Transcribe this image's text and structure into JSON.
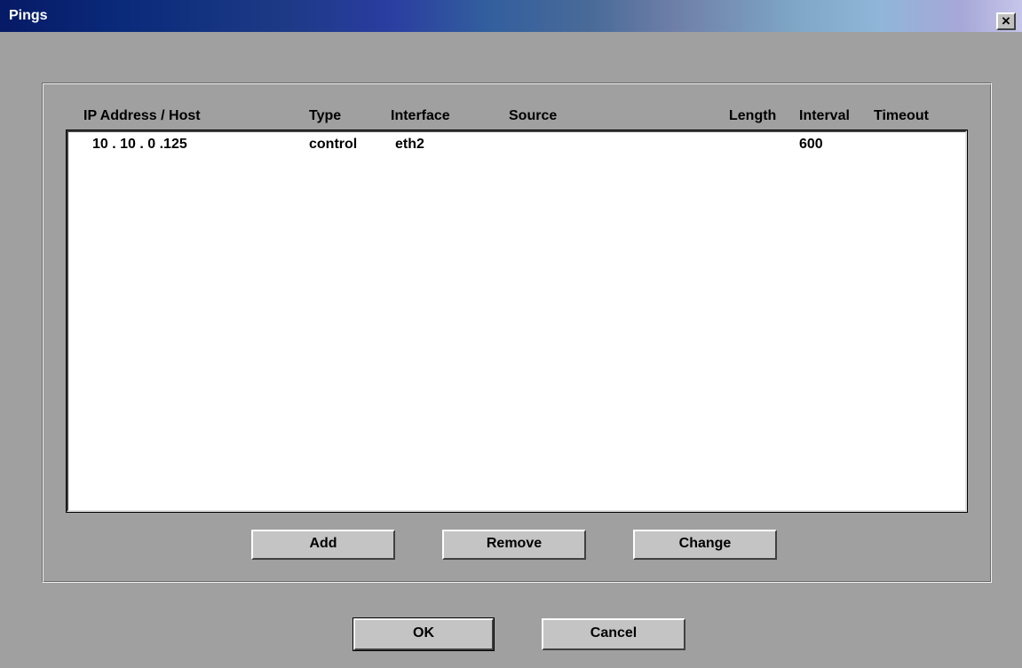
{
  "window": {
    "title": "Pings",
    "close_glyph": "×"
  },
  "table": {
    "headers": [
      "IP Address / Host",
      "Type",
      "Interface",
      "Source",
      "Length",
      "Interval",
      "Timeout"
    ],
    "rows": [
      {
        "ip": "10 . 10 . 0 .125",
        "type": "control",
        "interface": "eth2",
        "source": "",
        "length": "",
        "interval": "600",
        "timeout": ""
      }
    ]
  },
  "actions": {
    "add_label": "Add",
    "remove_label": "Remove",
    "change_label": "Change"
  },
  "dialog_buttons": {
    "ok_label": "OK",
    "cancel_label": "Cancel"
  },
  "colors": {
    "window_bg": "#a0a0a0",
    "list_bg": "#ffffff",
    "button_face": "#c4c4c4",
    "title_gradient_start": "#061a66",
    "title_gradient_end": "#c6c6ea"
  }
}
